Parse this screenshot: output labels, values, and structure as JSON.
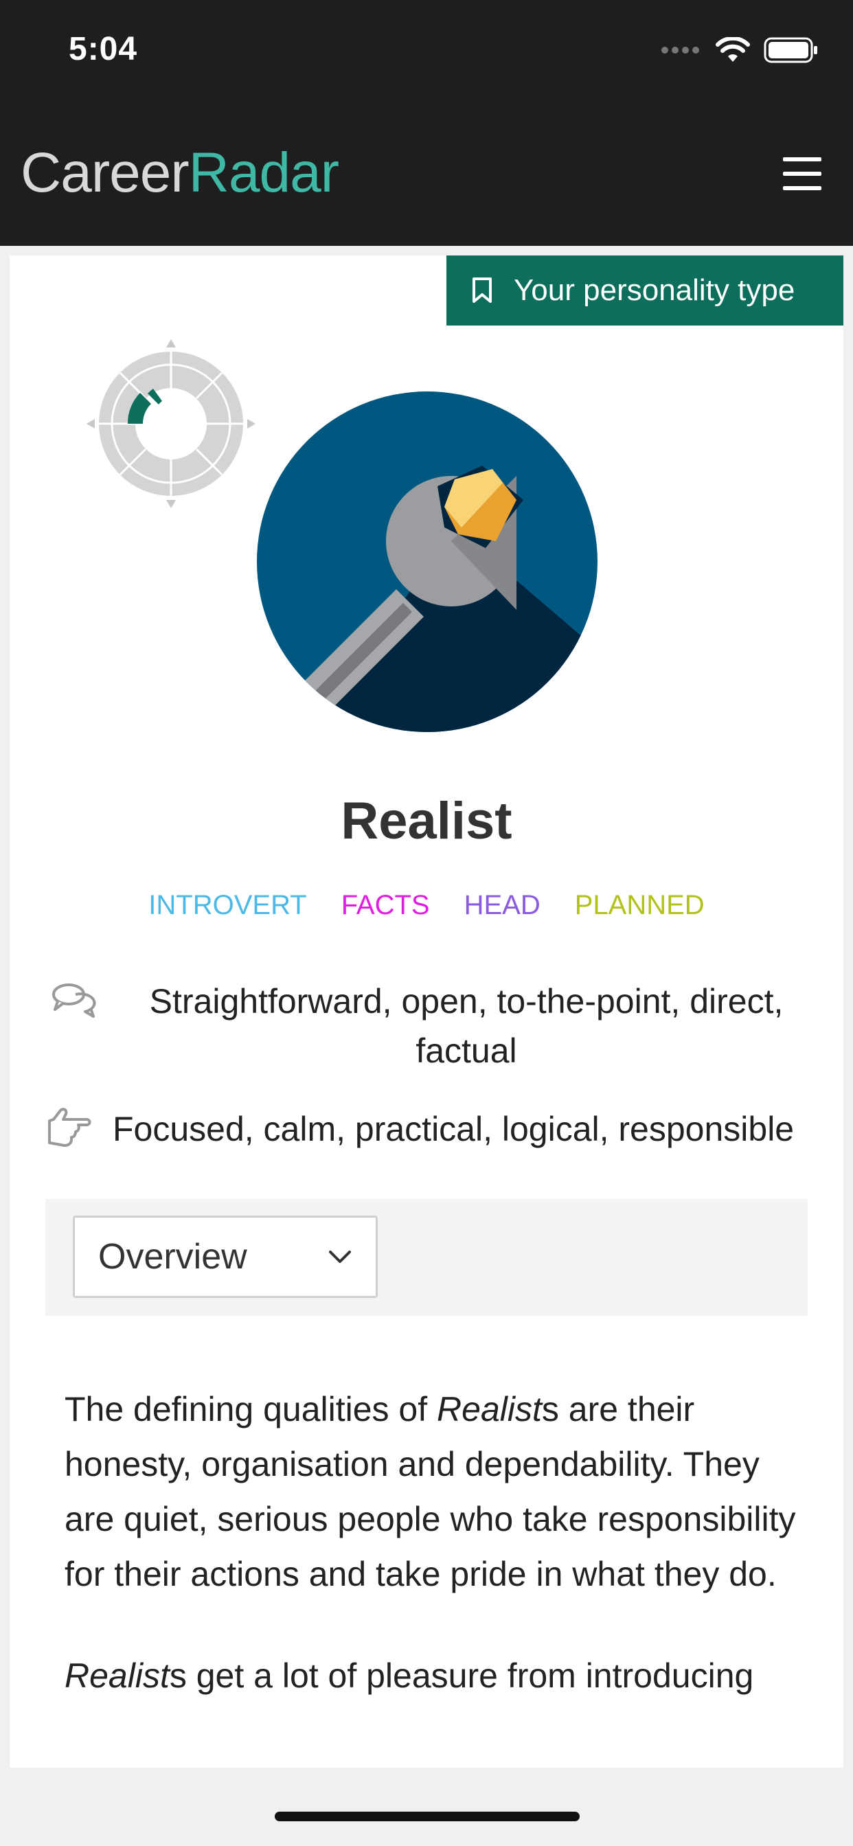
{
  "status_bar": {
    "time": "5:04"
  },
  "nav": {
    "logo_part1": "Career",
    "logo_part2": "Radar"
  },
  "badge": {
    "label": "Your personality type"
  },
  "profile": {
    "title": "Realist",
    "traits": [
      {
        "label": "INTROVERT",
        "color": "#4cb8e6"
      },
      {
        "label": "FACTS",
        "color": "#e01ee0"
      },
      {
        "label": "HEAD",
        "color": "#8a5be0"
      },
      {
        "label": "PLANNED",
        "color": "#b3c21a"
      }
    ],
    "communication": "Straightforward, open, to-the-point, direct, factual",
    "qualities": "Focused, calm, practical, logical, responsible"
  },
  "dropdown": {
    "selected": "Overview"
  },
  "content": {
    "p1_before": "The defining qualities of ",
    "p1_em": "Realist",
    "p1_after": "s are their honesty, organisation and dependability. They are quiet, serious people who take responsibility for their actions and take pride in what they do.",
    "p2_em": "Realist",
    "p2_after": "s get a lot of pleasure from introducing"
  },
  "colors": {
    "accent": "#0d6e5b",
    "nav_bg": "#1e1e1e",
    "logo_radar": "#3fb8a6"
  }
}
